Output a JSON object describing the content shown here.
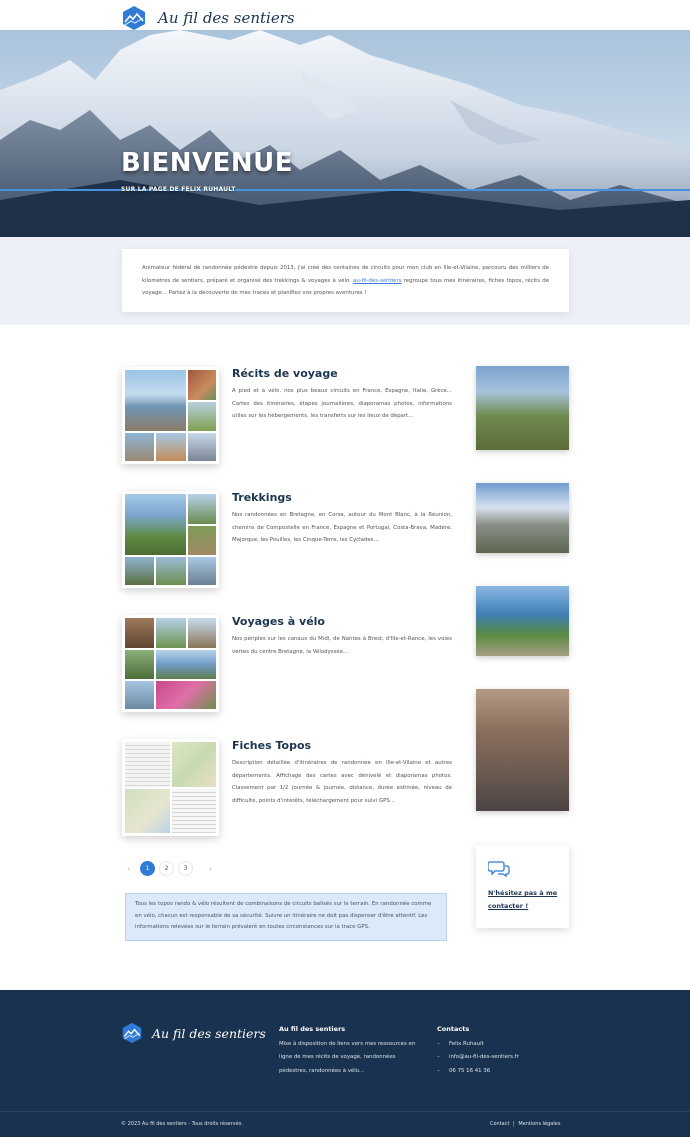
{
  "header": {
    "site_name": "Au fil des sentiers"
  },
  "hero": {
    "title": "BIENVENUE",
    "subtitle": "SUR LA PAGE DE FELIX RUHAULT"
  },
  "intro": {
    "text_before_link": "Animateur fédéral de randonnée pédestre depuis 2013, j'ai créé des centaines de circuits pour mon club en Ille-et-Vilaine, parcouru des milliers de kilomètres de sentiers, préparé et organisé des trekkings & voyages à vélo. ",
    "link": "au-fil-des-sentiers",
    "text_after_link": " regroupe tous mes itinéraires, fiches topos, récits de voyage... Partez à la découverte de mes traces et planifiez vos propres aventures !"
  },
  "articles": [
    {
      "title": "Récits de voyage",
      "text": "A pied et à vélo, nos plus beaux circuits en France, Espagne, Italie, Grèce... Cartes des itinéraires, étapes journalières, diaporamas photos, informations utiles sur les hébergements, les transferts sur les lieux de départ..."
    },
    {
      "title": "Trekkings",
      "text": "Nos randonnées en Bretagne, en Corse, autour du Mont Blanc, à la Réunion, chemins de Compostelle en France, Espagne et Portugal, Costa-Brava, Madère, Majorque, les Pouilles, les Cinque-Terre, les Cyclades..."
    },
    {
      "title": "Voyages à vélo",
      "text": "Nos périples sur les canaux du Midi, de Nantes à Brest, d'Ille-et-Rance, les voies vertes du centre Bretagne, la Vélodyssée..."
    },
    {
      "title": "Fiches Topos",
      "text": "Description détaillée d'itinéraires de randonnée en Ille-et-Vilaine et autres départements. Affichage des cartes avec dénivelé et diaporamas photos. Classement par 1/2 journée & journée, distance, durée estimée, niveau de difficulté, points d'intérêts, téléchargement pour suivi GPS..."
    }
  ],
  "pagination": {
    "prev": "‹",
    "pages": [
      "1",
      "2",
      "3"
    ],
    "active": "1",
    "next": "›"
  },
  "notice": {
    "text": "Tous les topos rando & vélo résultent de combinaisons de circuits balisés sur le terrain. En randonnée comme en vélo, chacun est responsable de sa sécurité. Suivre un itinéraire ne doit pas dispenser d'être attentif. Les informations relevées sur le terrain prévalent en toutes circonstances sur la trace GPS."
  },
  "contact_box": {
    "icon": "chat-bubbles-icon",
    "link_text": "N'hésitez pas à me contacter !"
  },
  "footer": {
    "site_name": "Au fil des sentiers",
    "about_title": "Au fil des sentiers",
    "about_text": "Mise à disposition de liens vers mes ressources en ligne de mes récits de voyage, randonnées pédestres, randonnées à vélo...",
    "contacts_title": "Contacts",
    "contacts": [
      "Felix Ruhault",
      "info@au-fil-des-sentiers.fr",
      "06 75 16 41 36"
    ],
    "copyright": "© 2023 Au fil des sentiers - Tous droits réservés.",
    "links": [
      "Contact",
      "Mentions légales"
    ],
    "link_separator": "|"
  },
  "colors": {
    "brand_navy": "#18324f",
    "accent_blue": "#2f7bd6",
    "title_navy": "#1c3550"
  }
}
